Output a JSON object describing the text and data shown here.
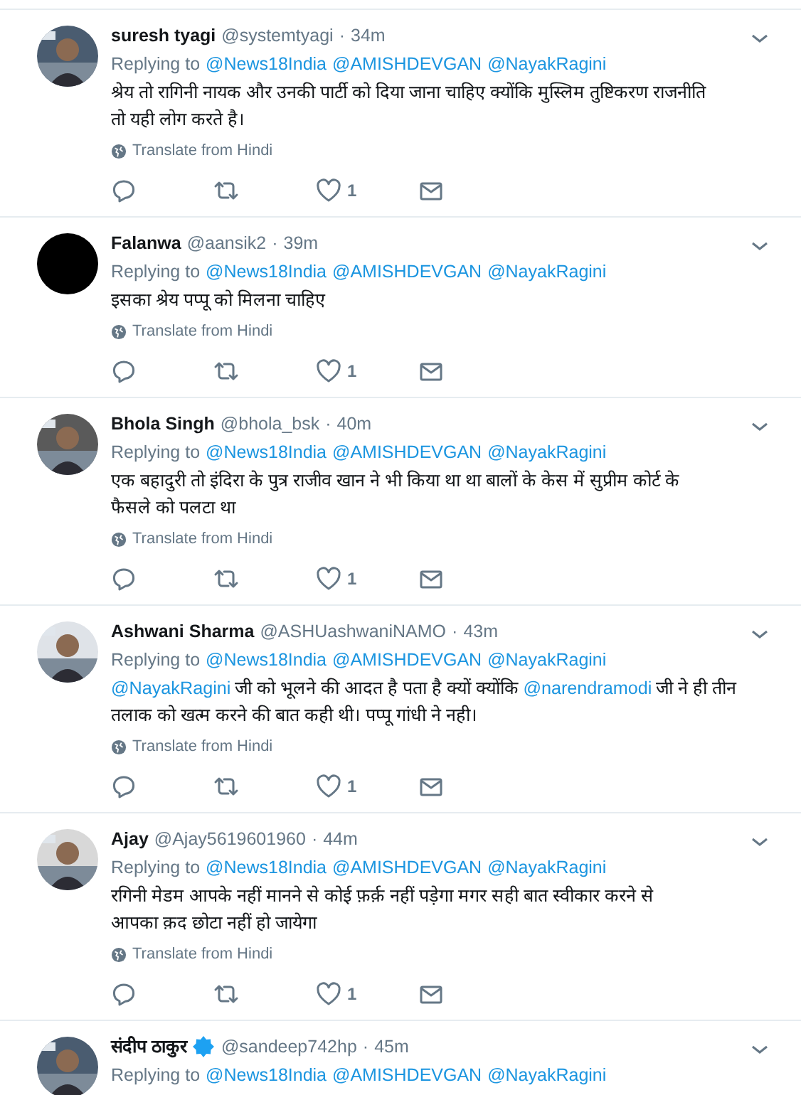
{
  "tweets": [
    {
      "name": "suresh tyagi",
      "verified": false,
      "handle": "@systemtyagi",
      "separator": "·",
      "time": "34m",
      "avatar": {
        "kind": "picture"
      },
      "replying_label": "Replying to",
      "replying_to": [
        "@News18India",
        "@AMISHDEVGAN",
        "@NayakRagini"
      ],
      "body_lines": [
        [
          {
            "kind": "text",
            "text": "श्रेय तो रागिनी नायक और उनकी पार्टी को दिया जाना चाहिए क्योंकि मुस्लिम तुष्टिकरण राजनीति"
          }
        ],
        [
          {
            "kind": "text",
            "text": "तो यही लोग करते है।"
          }
        ]
      ],
      "translate": "Translate from Hindi",
      "likes": "1"
    },
    {
      "name": "Falanwa",
      "verified": false,
      "handle": "@aansik2",
      "time": "39m",
      "avatar": {
        "kind": "blank"
      },
      "separator": "·",
      "replying_label": "Replying to",
      "replying_to": [
        "@News18India",
        "@AMISHDEVGAN",
        "@NayakRagini"
      ],
      "body_lines": [
        [
          {
            "kind": "text",
            "text": "इसका श्रेय पप्पू को मिलना चाहिए"
          }
        ]
      ],
      "translate": "Translate from Hindi",
      "likes": "1"
    },
    {
      "name": "Bhola Singh",
      "verified": false,
      "handle": "@bhola_bsk",
      "separator": "·",
      "time": "40m",
      "avatar": {
        "kind": "picture"
      },
      "replying_label": "Replying to",
      "replying_to": [
        "@News18India",
        "@AMISHDEVGAN",
        "@NayakRagini"
      ],
      "body_lines": [
        [
          {
            "kind": "text",
            "text": "एक बहादुरी तो इंदिरा के पुत्र राजीव खान ने भी किया था था बालों के केस में सुप्रीम कोर्ट के"
          }
        ],
        [
          {
            "kind": "text",
            "text": "फैसले को पलटा था"
          }
        ]
      ],
      "translate": "Translate from Hindi",
      "likes": "1"
    },
    {
      "name": "Ashwani Sharma",
      "verified": false,
      "handle": "@ASHUashwaniNAMO",
      "separator": "·",
      "time": "43m",
      "avatar": {
        "kind": "picture"
      },
      "replying_label": "Replying to",
      "replying_to": [
        "@News18India",
        "@AMISHDEVGAN",
        "@NayakRagini"
      ],
      "body_lines": [
        [
          {
            "kind": "mention",
            "text": "@NayakRagini"
          },
          {
            "kind": "text",
            "text": "जी को भूलने की आदत है पता है क्यों क्योंकि"
          },
          {
            "kind": "mention",
            "text": "@narendramodi"
          },
          {
            "kind": "text",
            "text": "जी ने ही तीन"
          }
        ],
        [
          {
            "kind": "text",
            "text": "तलाक को खत्म करने की बात कही थी। पप्पू गांधी ने नही।"
          }
        ]
      ],
      "translate": "Translate from Hindi",
      "likes": "1"
    },
    {
      "name": "Ajay",
      "verified": false,
      "handle": "@Ajay5619601960",
      "separator": "·",
      "time": "44m",
      "avatar": {
        "kind": "picture"
      },
      "replying_label": "Replying to",
      "replying_to": [
        "@News18India",
        "@AMISHDEVGAN",
        "@NayakRagini"
      ],
      "body_lines": [
        [
          {
            "kind": "text",
            "text": "रगिनी मेडम आपके नहीं मानने से कोई फ़र्क़ नहीं पड़ेगा मगर   सही बात स्वीकार करने से"
          }
        ],
        [
          {
            "kind": "text",
            "text": "आपका क़द छोटा नहीं हो जायेगा"
          }
        ]
      ],
      "translate": "Translate from Hindi",
      "likes": "1"
    },
    {
      "name": "संदीप ठाकुर",
      "verified": true,
      "handle": "@sandeep742hp",
      "separator": "·",
      "time": "45m",
      "avatar": {
        "kind": "picture"
      },
      "replying_label": "Replying to",
      "replying_to": [
        "@News18India",
        "@AMISHDEVGAN",
        "@NayakRagini"
      ]
    }
  ]
}
